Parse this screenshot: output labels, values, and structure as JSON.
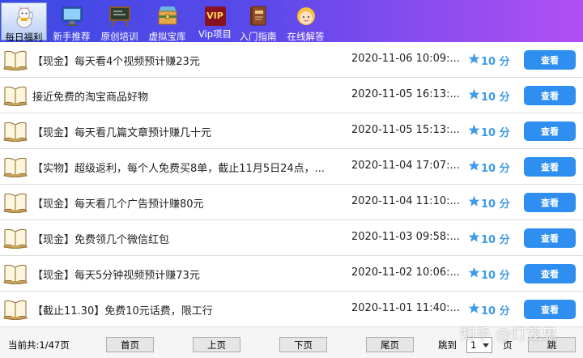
{
  "toolbar": {
    "items": [
      {
        "label": "每日福利",
        "icon": "lucky-cat-icon",
        "active": true
      },
      {
        "label": "新手推荐",
        "icon": "monitor-icon",
        "active": false
      },
      {
        "label": "原创培训",
        "icon": "blackboard-icon",
        "active": false
      },
      {
        "label": "虚拟宝库",
        "icon": "treasure-box-icon",
        "active": false
      },
      {
        "label": "Vip项目",
        "icon": "vip-icon",
        "active": false
      },
      {
        "label": "入门指南",
        "icon": "guide-book-icon",
        "active": false
      },
      {
        "label": "在线解答",
        "icon": "support-girl-icon",
        "active": false
      }
    ],
    "vip_badge": "VIP"
  },
  "list": {
    "view_label": "查看",
    "rows": [
      {
        "title": "【现金】每天看4个视频预计赚23元",
        "datetime": "2020-11-06  10:09:...",
        "score": "10 分"
      },
      {
        "title": "接近免费的淘宝商品好物",
        "datetime": "2020-11-05  16:13:...",
        "score": "10 分"
      },
      {
        "title": "【现金】每天看几篇文章预计赚几十元",
        "datetime": "2020-11-05  15:13:...",
        "score": "10 分"
      },
      {
        "title": "【实物】超级返利，每个人免费买8单，截止11月5日24点，...",
        "datetime": "2020-11-04  17:07:...",
        "score": "10 分"
      },
      {
        "title": "【现金】每天看几个广告预计赚80元",
        "datetime": "2020-11-04  11:10:...",
        "score": "10 分"
      },
      {
        "title": "【现金】免费领几个微信红包",
        "datetime": "2020-11-03  09:58:...",
        "score": "10 分"
      },
      {
        "title": "【现金】每天5分钟视频预计赚73元",
        "datetime": "2020-11-02  10:06:...",
        "score": "10 分"
      },
      {
        "title": "【截止11.30】免费10元话费，限工行",
        "datetime": "2020-11-01  11:40:...",
        "score": "10 分"
      }
    ]
  },
  "footer": {
    "page_info": "当前共:1/47页",
    "first_label": "首页",
    "prev_label": "上页",
    "next_label": "下页",
    "last_label": "尾页",
    "goto_label": "跳到",
    "page_select_value": "1",
    "page_unit": "页",
    "jump_label": "跳"
  },
  "watermark": "知乎 @灯笼鬼",
  "colors": {
    "toolbar_start": "#3c49e3",
    "toolbar_end": "#b150f2",
    "button_blue": "#2f8ff0",
    "score_blue": "#3f9ae8"
  }
}
